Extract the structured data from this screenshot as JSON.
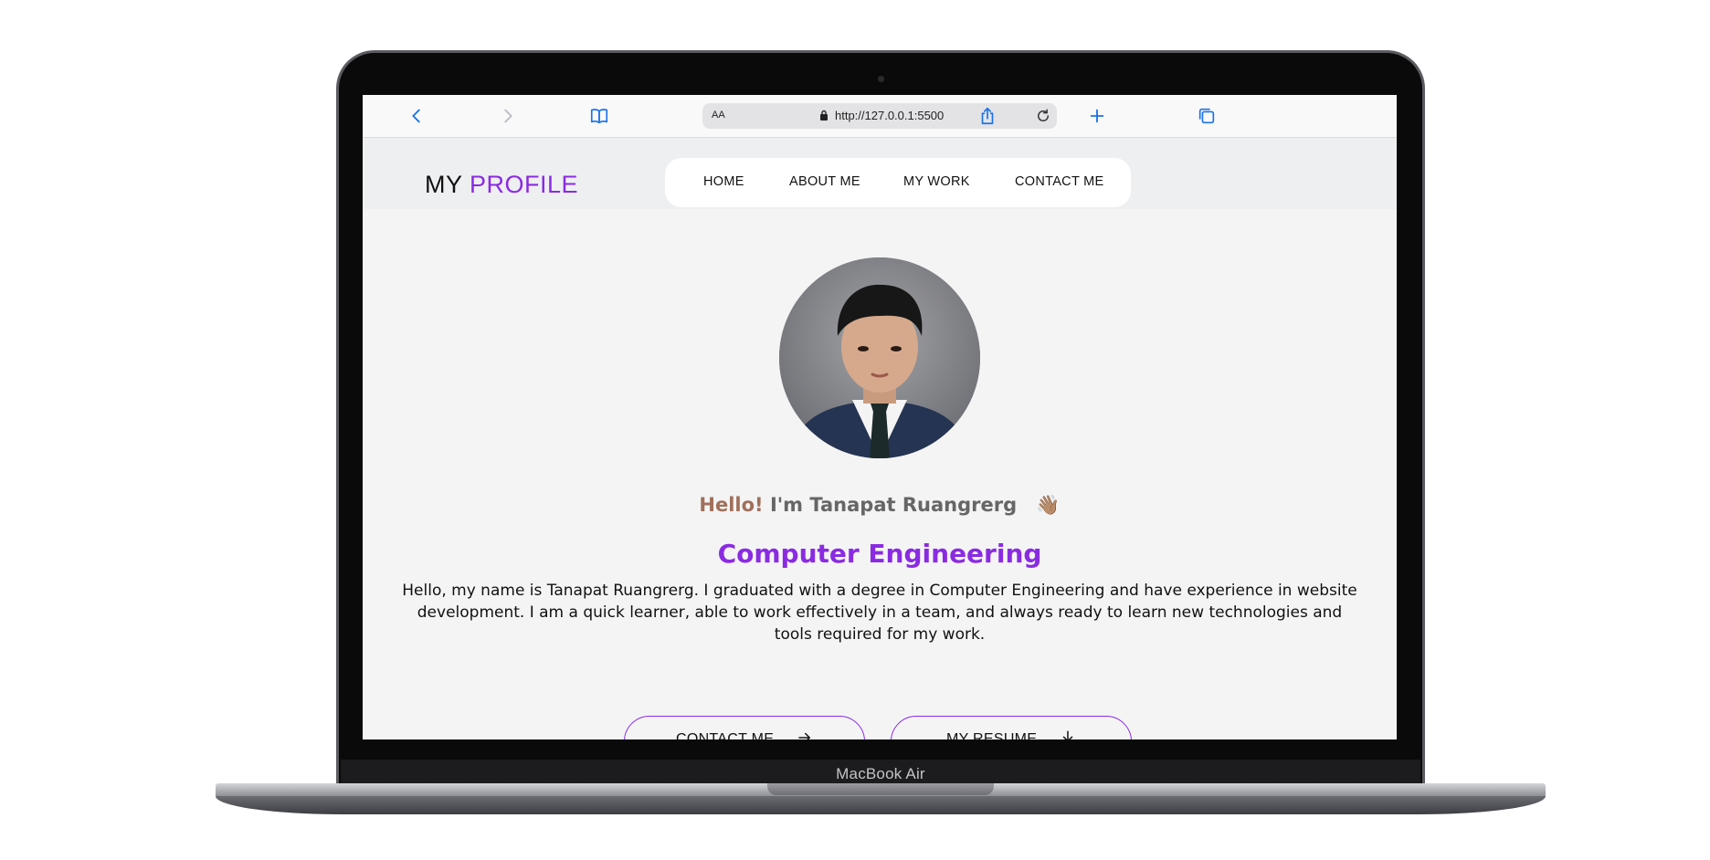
{
  "device": {
    "label": "MacBook Air"
  },
  "browser": {
    "text_size_label": "AA",
    "url": "http://127.0.0.1:5500",
    "icons": [
      "back-icon",
      "forward-icon",
      "bookmarks-icon",
      "lock-icon",
      "reload-icon",
      "share-icon",
      "new-tab-icon",
      "tabs-icon"
    ]
  },
  "site": {
    "logo": {
      "prefix": "MY",
      "accent": "PROFILE"
    },
    "nav": [
      {
        "label": "HOME"
      },
      {
        "label": "ABOUT ME"
      },
      {
        "label": "MY WORK"
      },
      {
        "label": "CONTACT ME"
      }
    ],
    "hero": {
      "greeting_hello": "Hello!",
      "greeting_name": "I'm Tanapat Ruangrerg",
      "greeting_emoji": "👋🏽",
      "role": "Computer Engineering",
      "bio": "Hello, my name is Tanapat Ruangrerg. I graduated with a degree in Computer Engineering and have experience in website development. I am a quick learner, able to work effectively in a team, and always ready to learn new technologies and tools required for my work.",
      "buttons": [
        {
          "label": "CONTACT ME",
          "icon": "arrow-right-icon"
        },
        {
          "label": "MY RESUME",
          "icon": "download-icon"
        }
      ]
    }
  },
  "colors": {
    "accent": "#8a2be2",
    "hello": "#a0705a",
    "link": "#1a73e8"
  }
}
